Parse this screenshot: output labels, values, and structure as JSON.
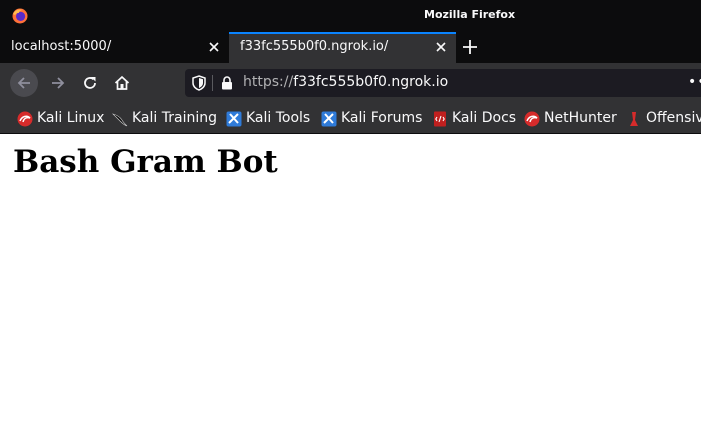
{
  "window": {
    "title": "Mozilla Firefox"
  },
  "tabs": [
    {
      "label": "localhost:5000/",
      "active": false
    },
    {
      "label": "f33fc555b0f0.ngrok.io/",
      "active": true
    }
  ],
  "navbar": {
    "url_scheme": "https://",
    "url_host": "f33fc555b0f0.ngrok.io",
    "overflow_label": "••"
  },
  "bookmarks": [
    {
      "label": "Kali Linux",
      "icon": "kali-linux-icon"
    },
    {
      "label": "Kali Training",
      "icon": "kali-training-icon"
    },
    {
      "label": "Kali Tools",
      "icon": "kali-tools-icon"
    },
    {
      "label": "Kali Forums",
      "icon": "kali-forums-icon"
    },
    {
      "label": "Kali Docs",
      "icon": "kali-docs-icon"
    },
    {
      "label": "NetHunter",
      "icon": "nethunter-icon"
    },
    {
      "label": "Offensive",
      "icon": "offensive-security-icon"
    }
  ],
  "page": {
    "heading": "Bash Gram Bot"
  },
  "colors": {
    "chrome_dark": "#0c0c0d",
    "toolbar": "#323234",
    "urlbar_bg": "#1c1b22",
    "accent": "#0a84ff",
    "text_light": "#f9f9fa"
  }
}
